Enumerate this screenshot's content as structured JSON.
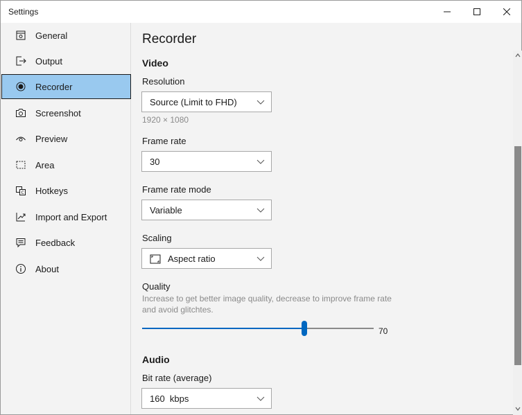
{
  "window": {
    "title": "Settings"
  },
  "sidebar": {
    "items": [
      {
        "label": "General",
        "icon": "general-icon"
      },
      {
        "label": "Output",
        "icon": "output-icon"
      },
      {
        "label": "Recorder",
        "icon": "recorder-icon",
        "selected": true
      },
      {
        "label": "Screenshot",
        "icon": "camera-icon"
      },
      {
        "label": "Preview",
        "icon": "eye-icon"
      },
      {
        "label": "Area",
        "icon": "area-icon"
      },
      {
        "label": "Hotkeys",
        "icon": "hotkeys-icon"
      },
      {
        "label": "Import and Export",
        "icon": "import-export-icon"
      },
      {
        "label": "Feedback",
        "icon": "feedback-icon"
      },
      {
        "label": "About",
        "icon": "info-icon"
      }
    ]
  },
  "main": {
    "title": "Recorder",
    "video": {
      "heading": "Video",
      "resolution": {
        "label": "Resolution",
        "value": "Source (Limit to FHD)",
        "hint": "1920 × 1080"
      },
      "frame_rate": {
        "label": "Frame rate",
        "value": "30"
      },
      "frame_rate_mode": {
        "label": "Frame rate mode",
        "value": "Variable"
      },
      "scaling": {
        "label": "Scaling",
        "value": "Aspect ratio"
      },
      "quality": {
        "label": "Quality",
        "hint_line1": "Increase to get better image quality, decrease to improve frame rate",
        "hint_line2": "and avoid glitchtes.",
        "value": "70",
        "level_fraction": 0.7
      }
    },
    "audio": {
      "heading": "Audio",
      "bit_rate": {
        "label": "Bit rate (average)",
        "value": "160  kbps"
      }
    }
  },
  "colors": {
    "accent": "#0067c0",
    "selected_bg": "#99c9ef",
    "window_bg": "#f3f3f3"
  }
}
